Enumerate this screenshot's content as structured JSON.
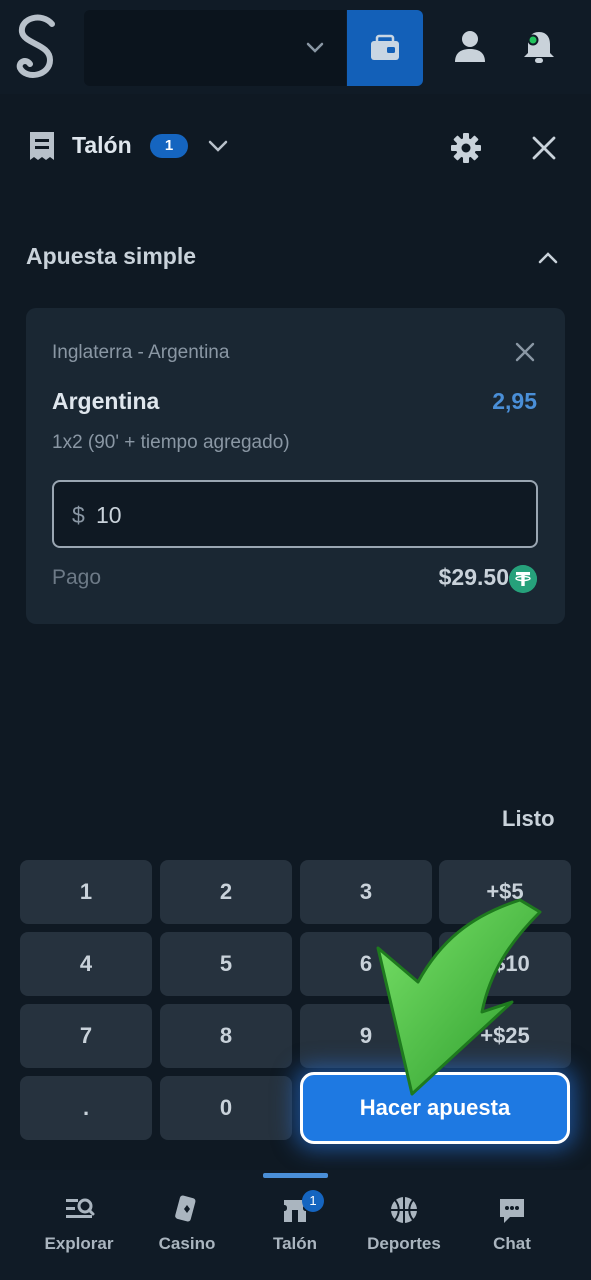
{
  "header": {
    "logo": "S"
  },
  "slip": {
    "title": "Talón",
    "count": "1"
  },
  "section": {
    "title": "Apuesta simple"
  },
  "bet": {
    "match": "Inglaterra - Argentina",
    "selection": "Argentina",
    "odds": "2,95",
    "market": "1x2 (90' + tiempo agregado)",
    "currency_symbol": "$",
    "stake": "10",
    "payout_label": "Pago",
    "payout_value": "$29.50"
  },
  "keypad": {
    "done_label": "Listo",
    "keys": [
      "1",
      "2",
      "3",
      "+$5",
      "4",
      "5",
      "6",
      "+$10",
      "7",
      "8",
      "9",
      "+$25",
      ".",
      "0"
    ],
    "place_bet_label": "Hacer apuesta"
  },
  "nav": {
    "items": [
      {
        "label": "Explorar"
      },
      {
        "label": "Casino"
      },
      {
        "label": "Talón",
        "badge": "1"
      },
      {
        "label": "Deportes"
      },
      {
        "label": "Chat"
      }
    ]
  },
  "colors": {
    "background": "#0f1923",
    "accent": "#1e79e2",
    "odds": "#4a8fd8",
    "card": "#1a2733",
    "key": "#26323e",
    "tether": "#26a17b",
    "arrow": "#3fbf3a"
  },
  "icons": [
    "logo-icon",
    "chevron-down-icon",
    "wallet-icon",
    "user-icon",
    "bell-icon",
    "betslip-icon",
    "gear-icon",
    "close-icon",
    "chevron-up-icon",
    "tether-icon",
    "explore-icon",
    "casino-icon",
    "chat-icon",
    "basketball-icon"
  ]
}
